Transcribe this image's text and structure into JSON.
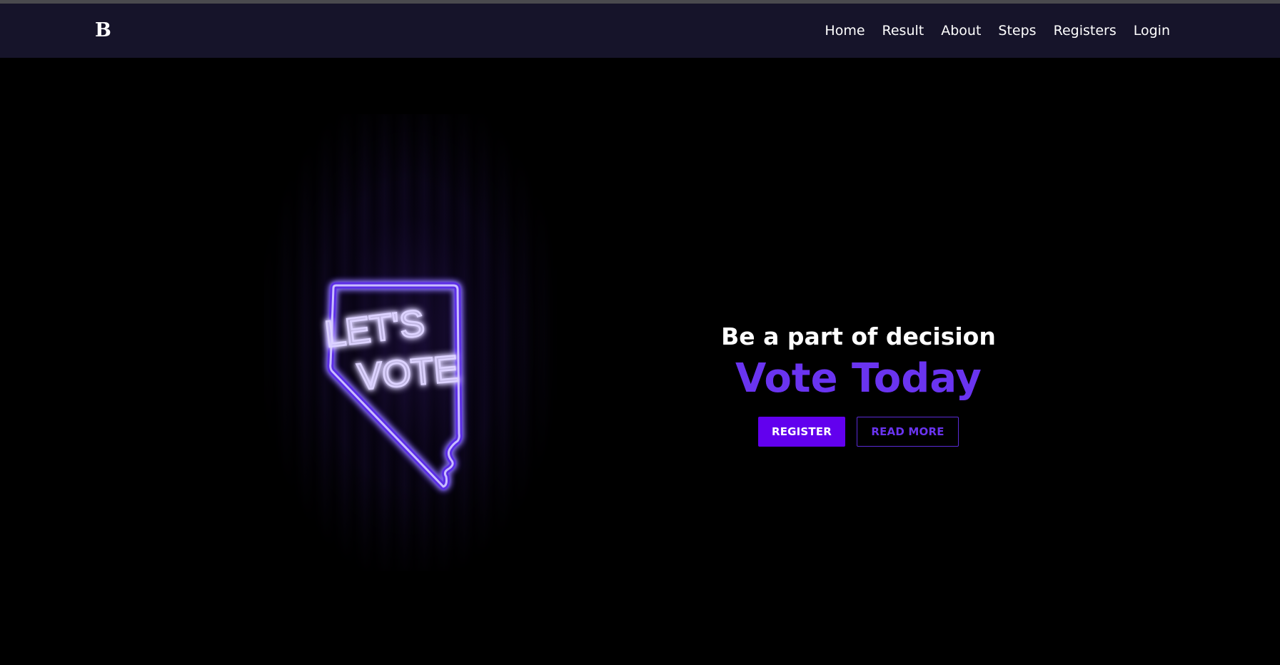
{
  "colors": {
    "nav_background": "#16142a",
    "page_background": "#000000",
    "accent": "#6200ee",
    "headline": "#6a34f0",
    "neon": "#b9a6ff"
  },
  "navbar": {
    "brand": "B",
    "links": [
      "Home",
      "Result",
      "About",
      "Steps",
      "Registers",
      "Login"
    ]
  },
  "hero": {
    "image": {
      "sign_line1": "LET'S",
      "sign_line2": "VOTE"
    },
    "tagline": "Be a part of decision",
    "headline": "Vote Today",
    "buttons": {
      "register": "REGISTER",
      "read_more": "READ MORE"
    }
  }
}
